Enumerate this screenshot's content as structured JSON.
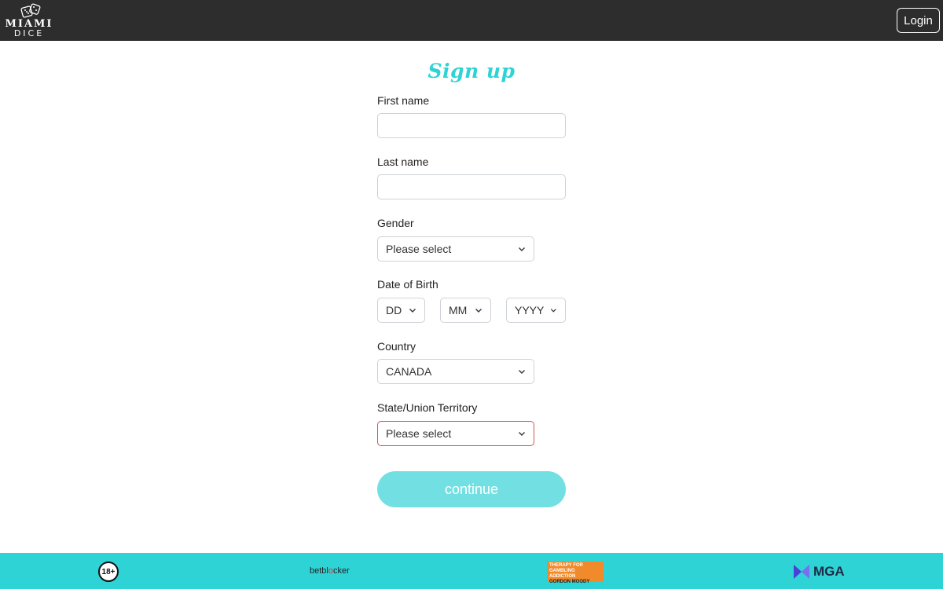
{
  "header": {
    "brand_top": "MIAMI",
    "brand_bottom": "DICE",
    "login_label": "Login"
  },
  "form": {
    "title": "Sign up",
    "first_name": {
      "label": "First name",
      "value": ""
    },
    "last_name": {
      "label": "Last name",
      "value": ""
    },
    "gender": {
      "label": "Gender",
      "selected": "Please select"
    },
    "dob": {
      "label": "Date of Birth",
      "day": "DD",
      "month": "MM",
      "year": "YYYY"
    },
    "country": {
      "label": "Country",
      "selected": "CANADA"
    },
    "state": {
      "label": "State/Union Territory",
      "selected": "Please select",
      "error": true
    },
    "continue_label": "continue"
  },
  "footer": {
    "age_badge": "18+",
    "betblocker_a": "bet",
    "betblocker_b": "bl",
    "betblocker_c": "cker",
    "gordon_line1": "THERAPY FOR",
    "gordon_line2": "GAMBLING ADDICTION",
    "gordon_line3": "GORDON MOODY",
    "mga_label": "MGA"
  },
  "colors": {
    "header_bg": "#2d2d2d",
    "accent": "#2fd3d6",
    "button_bg": "#72e0e2",
    "error_border": "#d9534f",
    "footer_bg": "#2ed3d6"
  }
}
